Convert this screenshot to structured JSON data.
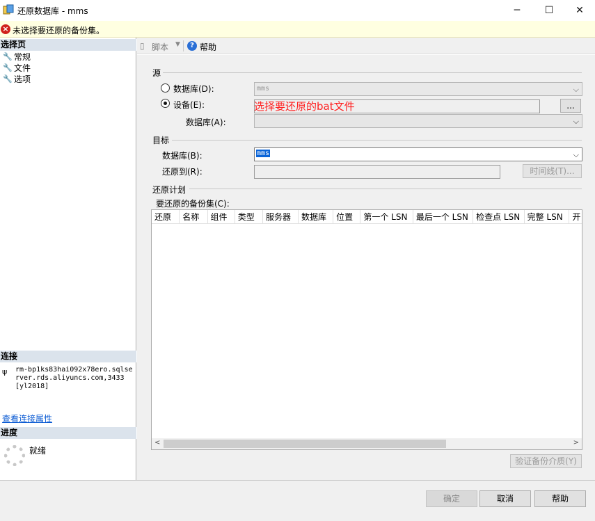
{
  "window": {
    "title": "还原数据库 - mms",
    "minimize": "─",
    "maximize": "☐",
    "close": "✕"
  },
  "error": {
    "message": "未选择要还原的备份集。"
  },
  "left": {
    "select_page_header": "选择页",
    "nav_items": [
      "常规",
      "文件",
      "选项"
    ],
    "connection_header": "连接",
    "connection_text": "rm-bp1ks83hai092x78ero.sqlserver.rds.aliyuncs.com,3433 [yl2018]",
    "view_conn_link": "查看连接属性",
    "progress_header": "进度",
    "progress_status": "就绪"
  },
  "toolbar": {
    "script_label": "脚本",
    "help_label": "帮助"
  },
  "source": {
    "title": "源",
    "database_radio": "数据库(D):",
    "database_value": "mms",
    "device_radio": "设备(E):",
    "device_browse": "...",
    "device_db_label": "数据库(A):",
    "selected": "device"
  },
  "annotation": "选择要还原的bat文件",
  "target": {
    "title": "目标",
    "database_label": "数据库(B):",
    "database_value": "mms",
    "restore_to_label": "还原到(R):",
    "timeline_button": "时间线(T)..."
  },
  "plan": {
    "title": "还原计划",
    "backup_sets_label": "要还原的备份集(C):",
    "columns": [
      "还原",
      "名称",
      "组件",
      "类型",
      "服务器",
      "数据库",
      "位置",
      "第一个 LSN",
      "最后一个 LSN",
      "检查点 LSN",
      "完整 LSN",
      "开"
    ],
    "verify_button": "验证备份介质(Y)"
  },
  "buttons": {
    "ok": "确定",
    "cancel": "取消",
    "help": "帮助"
  }
}
